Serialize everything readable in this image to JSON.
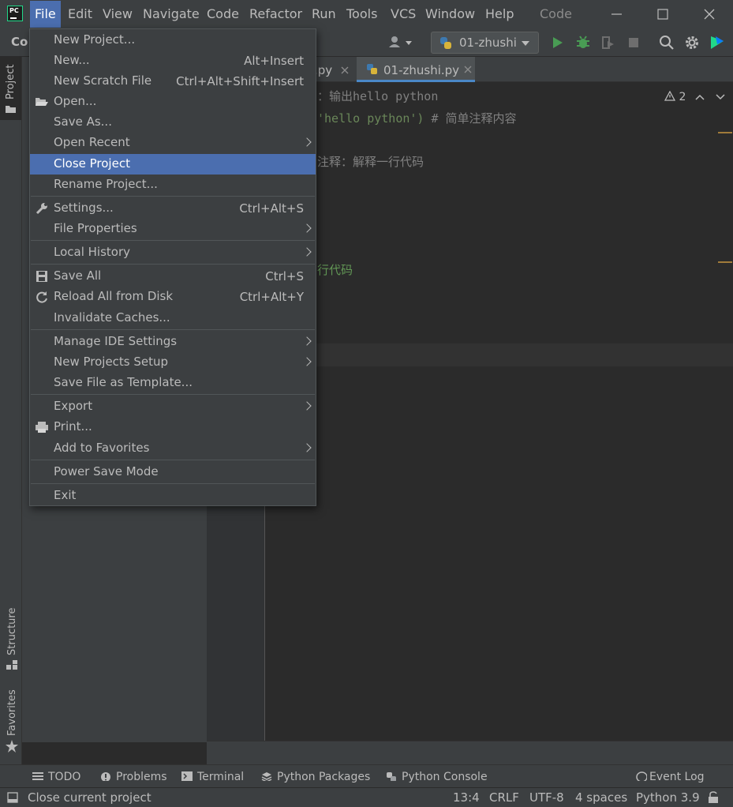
{
  "titlebar": {
    "menus": [
      "File",
      "Edit",
      "View",
      "Navigate",
      "Code",
      "Refactor",
      "Run",
      "Tools",
      "VCS",
      "Window",
      "Help"
    ],
    "title": "Code"
  },
  "toolbar": {
    "project_crumb": "Co",
    "run_config": "01-zhushi"
  },
  "editor_tabs": [
    {
      "label": ".py",
      "active": false
    },
    {
      "label": "01-zhushi.py",
      "active": true
    }
  ],
  "editor": {
    "lines": [
      {
        "text": "：输出hello python"
      },
      {
        "prefix": "",
        "str": "'hello python')",
        "comment": " # 简单注释内容"
      },
      {
        "text": "注释：解释一行代码"
      },
      {
        "text": "行代码"
      }
    ],
    "warning_count": "2"
  },
  "side_tabs": {
    "project": "Project",
    "structure": "Structure",
    "favorites": "Favorites"
  },
  "file_menu": {
    "items": [
      {
        "label": "New Project...",
        "shortcut": ""
      },
      {
        "label": "New...",
        "shortcut": "Alt+Insert"
      },
      {
        "label": "New Scratch File",
        "shortcut": "Ctrl+Alt+Shift+Insert"
      },
      {
        "label": "Open...",
        "shortcut": ""
      },
      {
        "label": "Save As...",
        "shortcut": ""
      },
      {
        "label": "Open Recent",
        "shortcut": ""
      },
      {
        "label": "Close Project",
        "shortcut": ""
      },
      {
        "label": "Rename Project...",
        "shortcut": ""
      },
      {
        "label": "Settings...",
        "shortcut": "Ctrl+Alt+S"
      },
      {
        "label": "File Properties",
        "shortcut": ""
      },
      {
        "label": "Local History",
        "shortcut": ""
      },
      {
        "label": "Save All",
        "shortcut": "Ctrl+S"
      },
      {
        "label": "Reload All from Disk",
        "shortcut": "Ctrl+Alt+Y"
      },
      {
        "label": "Invalidate Caches...",
        "shortcut": ""
      },
      {
        "label": "Manage IDE Settings",
        "shortcut": ""
      },
      {
        "label": "New Projects Setup",
        "shortcut": ""
      },
      {
        "label": "Save File as Template...",
        "shortcut": ""
      },
      {
        "label": "Export",
        "shortcut": ""
      },
      {
        "label": "Print...",
        "shortcut": ""
      },
      {
        "label": "Add to Favorites",
        "shortcut": ""
      },
      {
        "label": "Power Save Mode",
        "shortcut": ""
      },
      {
        "label": "Exit",
        "shortcut": ""
      }
    ],
    "highlighted": "Close Project"
  },
  "tool_windows": [
    "TODO",
    "Problems",
    "Terminal",
    "Python Packages",
    "Python Console",
    "Event Log"
  ],
  "statusbar": {
    "message": "Close current project",
    "position": "13:4",
    "line_sep": "CRLF",
    "encoding": "UTF-8",
    "indent": "4 spaces",
    "interpreter": "Python 3.9"
  },
  "colors": {
    "accent": "#4b6eaf",
    "panel": "#3c3f41",
    "editor_bg": "#2b2b2b",
    "run_green": "#499c54",
    "tab_underline": "#4a88c7"
  }
}
